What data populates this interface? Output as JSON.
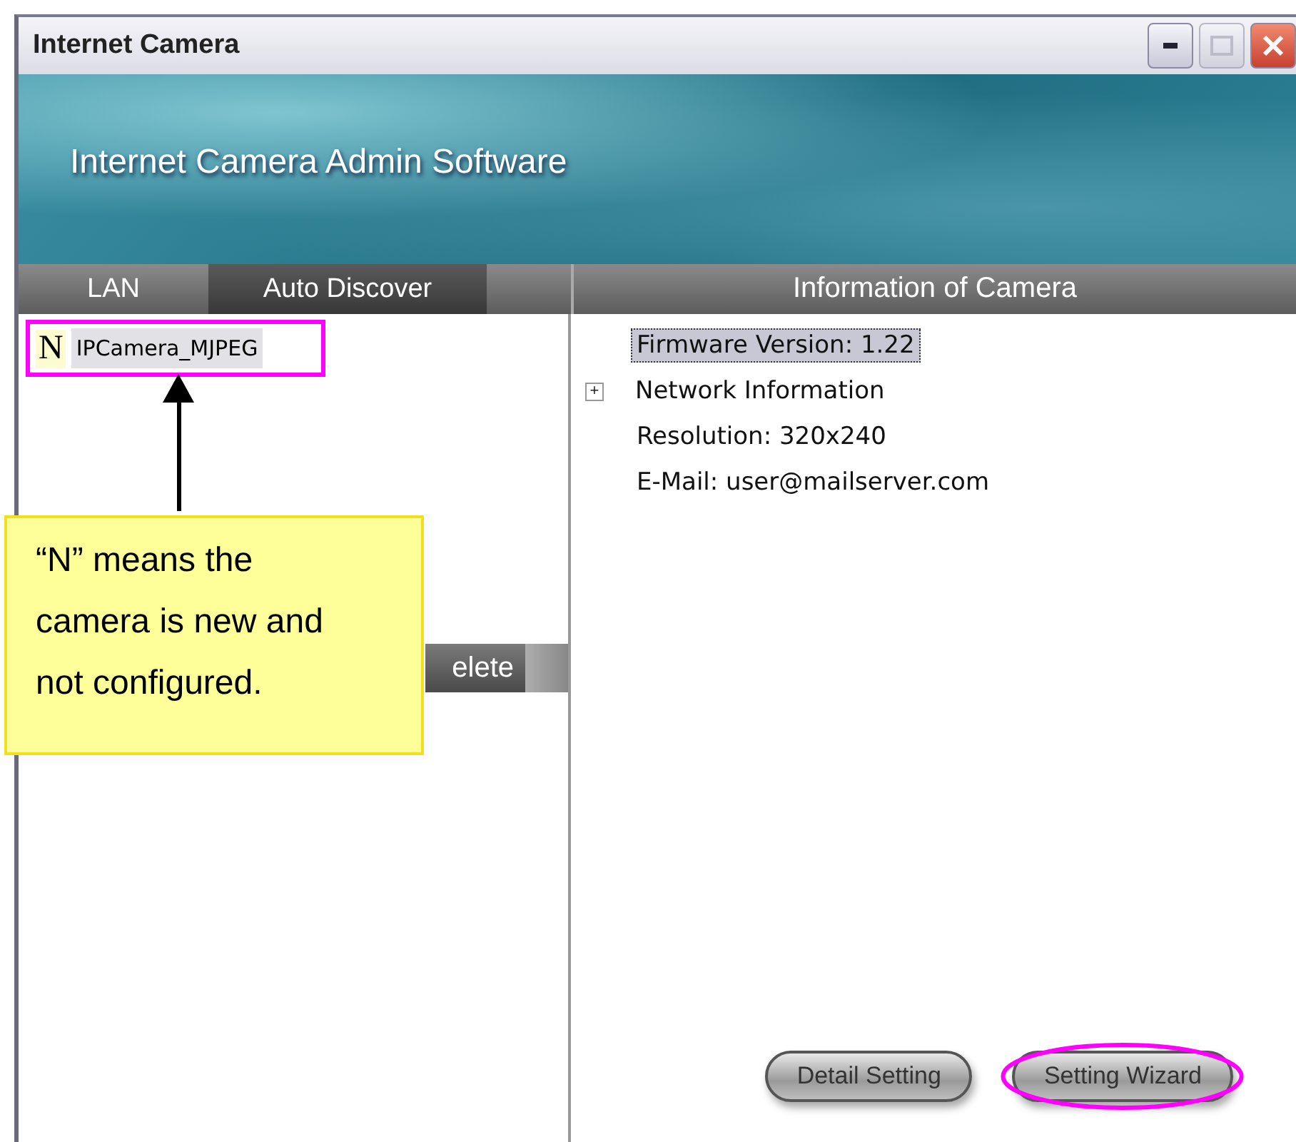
{
  "window": {
    "title": "Internet Camera",
    "controls": [
      {
        "kind": "minimize",
        "disabled": false
      },
      {
        "kind": "maximize",
        "disabled": true
      },
      {
        "kind": "close",
        "disabled": false
      }
    ]
  },
  "banner": {
    "title": "Internet Camera Admin Software"
  },
  "tabs": [
    {
      "label": "LAN",
      "selected": false
    },
    {
      "label": "Auto Discover",
      "selected": true
    }
  ],
  "camera_list": {
    "items": [
      {
        "badge": "N",
        "name": "IPCamera_MJPEG",
        "highlighted": true
      }
    ],
    "button_fragment": "elete"
  },
  "info_panel": {
    "heading": "Information of Camera",
    "tree": [
      {
        "kind": "leaf",
        "label": "Firmware Version:  1.22",
        "selected": true
      },
      {
        "kind": "branch",
        "label": "Network Information",
        "selected": false,
        "expanded": false,
        "expander": "+"
      },
      {
        "kind": "leaf",
        "label": "Resolution: 320x240",
        "selected": false
      },
      {
        "kind": "leaf",
        "label": "E-Mail: user@mailserver.com",
        "selected": false
      }
    ]
  },
  "buttons": [
    {
      "label": "Detail Setting",
      "highlighted": false
    },
    {
      "label": "Setting Wizard",
      "highlighted": true
    }
  ],
  "callout": {
    "lines": [
      "“N” means the",
      "camera is new and",
      "not configured."
    ]
  }
}
